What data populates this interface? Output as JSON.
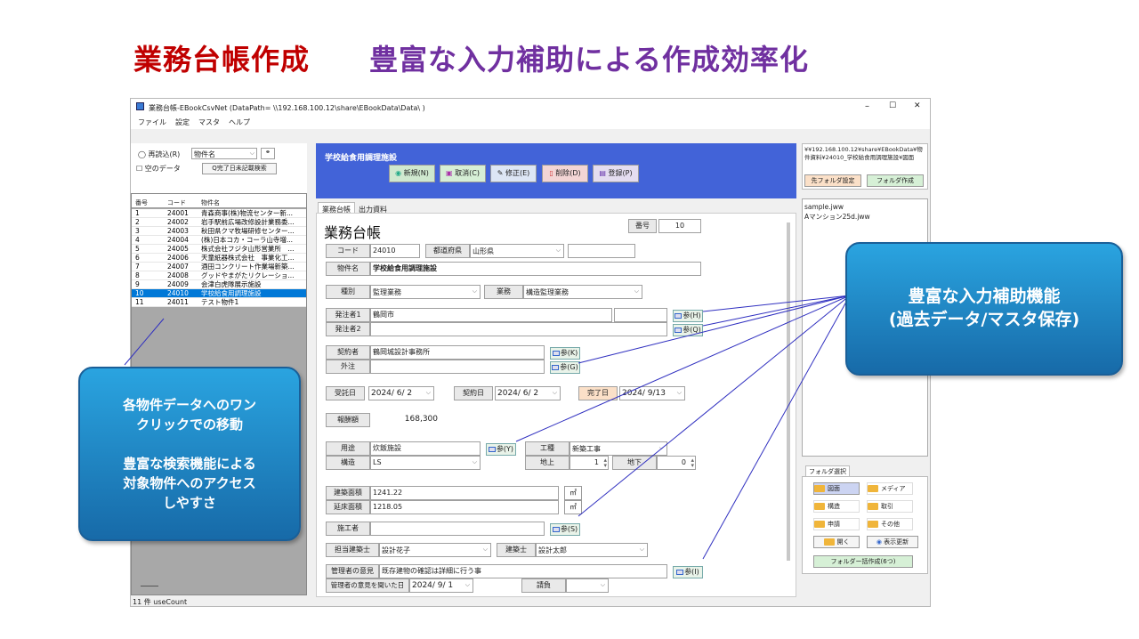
{
  "slide": {
    "title": "業務台帳作成",
    "subtitle": "豊富な入力補助による作成効率化"
  },
  "window": {
    "title": "業務台帳-EBookCsvNet (DataPath= \\\\192.168.100.12\\share\\EBookData\\Data\\ )",
    "min": "–",
    "max": "☐",
    "close": "✕"
  },
  "menu": [
    "ファイル",
    "設定",
    "マスタ",
    "ヘルプ"
  ],
  "left": {
    "reload": "再読込(R)",
    "field_select": "物件名",
    "search_icon": "binoculars-icon",
    "empty_data": "空のデータ",
    "unrecorded_search": "Q完了日未記載検索",
    "headers": [
      "番号",
      "コード",
      "物件名"
    ],
    "rows": [
      [
        "1",
        "24001",
        "青森商事(株)物流センター新..."
      ],
      [
        "2",
        "24002",
        "岩手駅前広場改修設計業務委..."
      ],
      [
        "3",
        "24003",
        "秋田県クマ牧場研修センター..."
      ],
      [
        "4",
        "24004",
        "(株)日本コカ・コーラ山寺増..."
      ],
      [
        "5",
        "24005",
        "株式会社フジタ山形営業所　..."
      ],
      [
        "6",
        "24006",
        "天童紙器株式会社　事業化工..."
      ],
      [
        "7",
        "24007",
        "酒田コンクリート作業場新築..."
      ],
      [
        "8",
        "24008",
        "グッドやまがたリクレーショ..."
      ],
      [
        "9",
        "24009",
        "会津白虎隊展示施設"
      ],
      [
        "10",
        "24010",
        "学校給食用調理施設"
      ],
      [
        "11",
        "24011",
        "テスト物件1"
      ]
    ],
    "selected": "10",
    "status": "11 件  useCount"
  },
  "header": {
    "project_title": "学校給食用調理施設",
    "buttons": {
      "new": "新規(N)",
      "cancel": "取消(C)",
      "edit": "修正(E)",
      "delete": "削除(D)",
      "register": "登録(P)"
    }
  },
  "tabs": [
    "業務台帳",
    "出力資料"
  ],
  "form": {
    "heading": "業務台帳",
    "num_label": "番号",
    "num": "10",
    "code_label": "コード",
    "code": "24010",
    "pref_label": "都道府県",
    "pref": "山形県",
    "name_label": "物件名",
    "name": "学校給食用調理施設",
    "type_label": "種別",
    "type": "監理業務",
    "work_label": "業務",
    "work": "構造監理業務",
    "orderer1_label": "発注者1",
    "orderer1": "鶴岡市",
    "orderer2_label": "発注者2",
    "ref_h": "参(H)",
    "ref_q": "参(Q)",
    "contractor_label": "契約者",
    "contractor": "鶴岡城設計事務所",
    "outsource_label": "外注",
    "ref_k": "参(K)",
    "ref_g": "参(G)",
    "received_label": "受託日",
    "received": "2024/ 6/ 2",
    "contract_label": "契約日",
    "contract": "2024/ 6/ 2",
    "complete_label": "完了日",
    "complete": "2024/ 9/13",
    "fee_label": "報酬額",
    "fee": "168,300",
    "use_label": "用途",
    "use": "炊飯施設",
    "ref_y": "参(Y)",
    "kind_label": "工種",
    "kind": "新築工事",
    "struct_label": "構造",
    "struct": "LS",
    "above_label": "地上",
    "above": "1",
    "below_label": "地下",
    "below": "0",
    "build_area_label": "建築面積",
    "build_area": "1241.22",
    "floor_area_label": "延床面積",
    "floor_area": "1218.05",
    "unit": "㎡",
    "builder_label": "施工者",
    "ref_s": "参(S)",
    "arch1_label": "担当建築士",
    "arch1": "設計花子",
    "arch2_label": "建築士",
    "arch2": "設計太郎",
    "opinion_label": "管理者の意見",
    "opinion": "既存建物の確認は詳細に行う事",
    "ref_i": "参(I)",
    "opinion_date_label": "管理者の意見を聞いた日",
    "opinion_date": "2024/ 9/ 1",
    "settle_label": "請負"
  },
  "right": {
    "path": "¥¥192.168.100.12¥share¥EBookData¥物件資料¥24010_学校給食用調理施設¥図面",
    "dest_btn": "先フォルダ設定",
    "make_btn": "フォルダ作成",
    "files": [
      "sample.jww",
      "Aマンション25d.jww"
    ],
    "folder_sel": "フォルダ選択",
    "folders": [
      "図面",
      "メディア",
      "構造",
      "取引",
      "申請",
      "その他"
    ],
    "open": "開く",
    "refresh": "表示更新",
    "bulk": "フォルダー括作成(6つ)"
  },
  "callouts": {
    "right": "豊富な入力補助機能\n(過去データ/マスタ保存)",
    "left": "各物件データへのワン\nクリックでの移動\n\n豊富な検索機能による\n対象物件へのアクセス\nしやすさ"
  }
}
